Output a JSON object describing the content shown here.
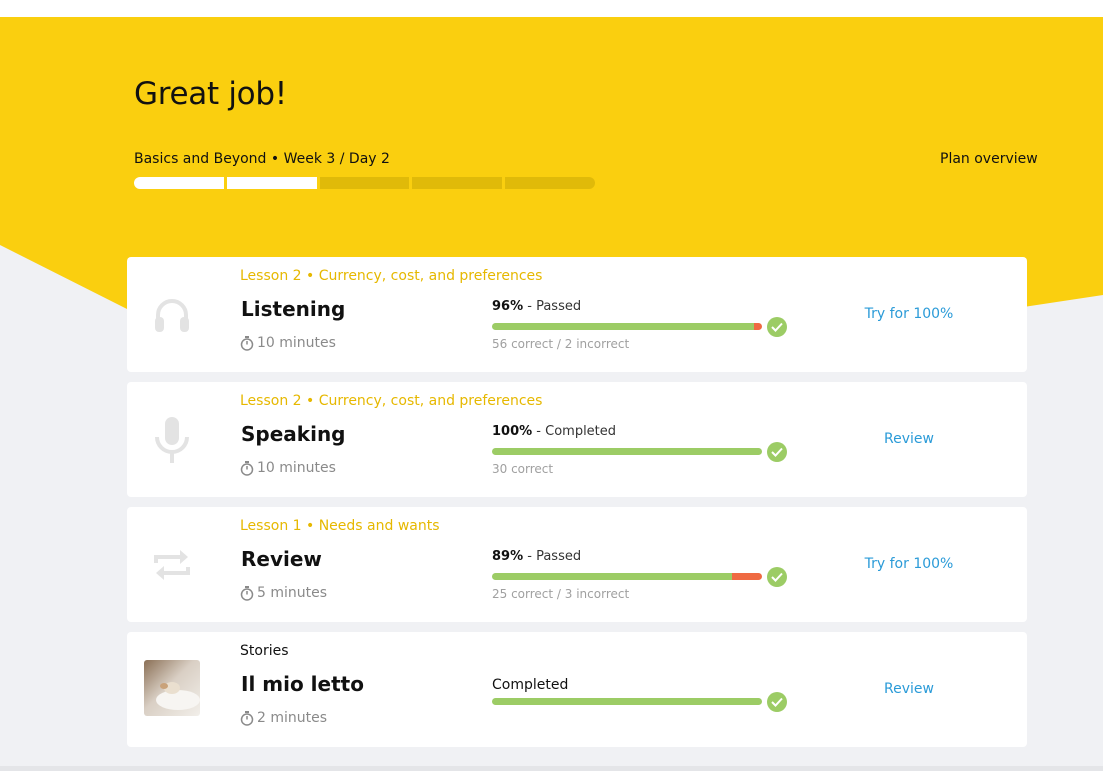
{
  "header": {
    "title": "Great job!",
    "plan_label": "Basics and Beyond • Week 3 / Day 2",
    "plan_overview_label": "Plan overview",
    "progress": {
      "total_days": 5,
      "completed_days": 2
    },
    "background_color": "#facf0f"
  },
  "activities": [
    {
      "icon": "headphones-icon",
      "lesson": "Lesson 2 • Currency, cost, and preferences",
      "title": "Listening",
      "duration": "10 minutes",
      "score_percent": "96%",
      "score_status": " - Passed",
      "correct_fraction": 0.97,
      "counts": "56 correct / 2 incorrect",
      "action": "Try for 100%"
    },
    {
      "icon": "microphone-icon",
      "lesson": "Lesson 2 • Currency, cost, and preferences",
      "title": "Speaking",
      "duration": "10 minutes",
      "score_percent": "100%",
      "score_status": " - Completed",
      "correct_fraction": 1.0,
      "counts": "30 correct",
      "action": "Review"
    },
    {
      "icon": "repeat-icon",
      "lesson": "Lesson 1 • Needs and wants",
      "title": "Review",
      "duration": "5 minutes",
      "score_percent": "89%",
      "score_status": " - Passed",
      "correct_fraction": 0.89,
      "counts": "25 correct / 3 incorrect",
      "action": "Try for 100%"
    },
    {
      "icon": "story-thumbnail",
      "lesson": "Stories",
      "title": "Il mio letto",
      "duration": "2 minutes",
      "status": "Completed",
      "correct_fraction": 1.0,
      "action": "Review"
    }
  ],
  "colors": {
    "accent_yellow": "#facf0f",
    "lesson_label": "#e6b800",
    "correct_green": "#9ccc65",
    "incorrect_red": "#ef6a42",
    "link_blue": "#2b9bd8"
  }
}
